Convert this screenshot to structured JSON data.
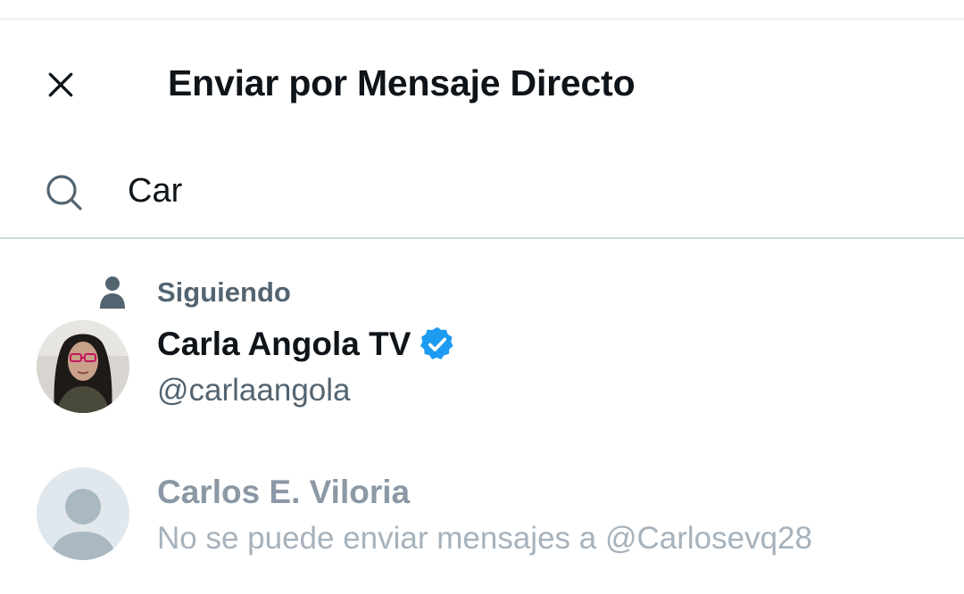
{
  "header": {
    "title": "Enviar por Mensaje Directo",
    "close_icon": "close-icon"
  },
  "search": {
    "value": "Car",
    "icon": "search-icon"
  },
  "context": {
    "icon": "person-icon",
    "label": "Siguiendo"
  },
  "results": [
    {
      "name": "Carla Angola TV",
      "handle": "@carlaangola",
      "verified": true,
      "enabled": true
    },
    {
      "name": "Carlos E. Viloria",
      "handle": "No se puede enviar mensajes a @Carlosevq28",
      "verified": false,
      "enabled": false
    }
  ],
  "colors": {
    "text_primary": "#0f1419",
    "text_secondary": "#536471",
    "disabled_text": "#8b98a5",
    "verified_blue": "#1d9bf0",
    "divider": "#cfd9de"
  }
}
